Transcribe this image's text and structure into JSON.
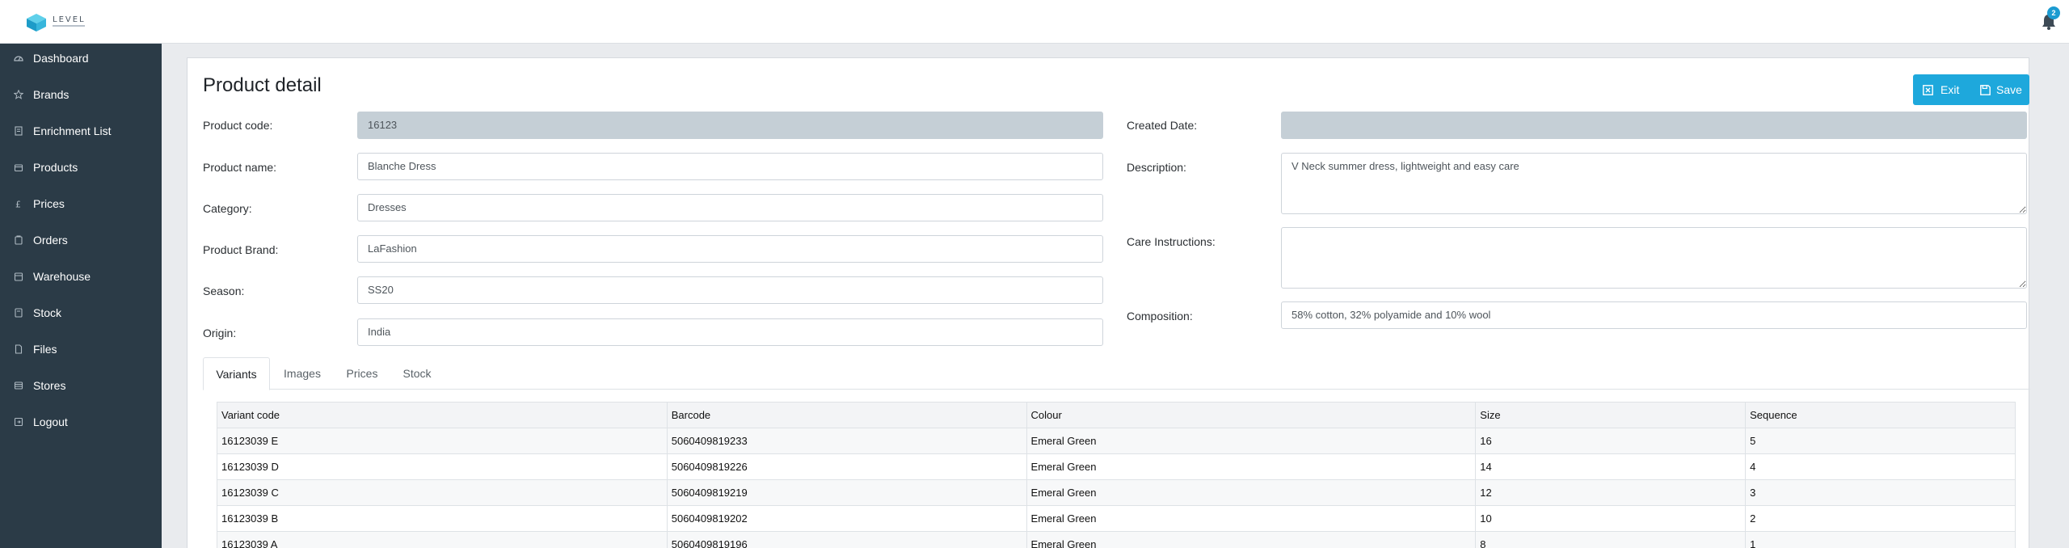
{
  "logo": {
    "text": "LEVEL"
  },
  "notifications": {
    "count": "2"
  },
  "sidebar": {
    "items": [
      {
        "label": "Dashboard",
        "icon": "dashboard-icon"
      },
      {
        "label": "Brands",
        "icon": "star-icon"
      },
      {
        "label": "Enrichment List",
        "icon": "document-icon"
      },
      {
        "label": "Products",
        "icon": "box-icon"
      },
      {
        "label": "Prices",
        "icon": "pound-icon"
      },
      {
        "label": "Orders",
        "icon": "cart-icon"
      },
      {
        "label": "Warehouse",
        "icon": "warehouse-icon"
      },
      {
        "label": "Stock",
        "icon": "stock-icon"
      },
      {
        "label": "Files",
        "icon": "file-icon"
      },
      {
        "label": "Stores",
        "icon": "store-icon"
      },
      {
        "label": "Logout",
        "icon": "logout-icon"
      }
    ]
  },
  "page": {
    "title": "Product detail"
  },
  "toolbar": {
    "exit_label": "Exit",
    "save_label": "Save"
  },
  "form": {
    "product_code": {
      "label": "Product code:",
      "value": "16123"
    },
    "product_name": {
      "label": "Product name:",
      "value": "Blanche Dress"
    },
    "category": {
      "label": "Category:",
      "value": "Dresses"
    },
    "product_brand": {
      "label": "Product Brand:",
      "value": "LaFashion"
    },
    "season": {
      "label": "Season:",
      "value": "SS20"
    },
    "origin": {
      "label": "Origin:",
      "value": "India"
    },
    "created_date": {
      "label": "Created Date:",
      "value": ""
    },
    "description": {
      "label": "Description:",
      "value": "V Neck summer dress, lightweight and easy care"
    },
    "care_instructions": {
      "label": "Care Instructions:",
      "value": ""
    },
    "composition": {
      "label": "Composition:",
      "value": "58% cotton, 32% polyamide and 10% wool"
    }
  },
  "tabs": [
    {
      "label": "Variants",
      "active": true
    },
    {
      "label": "Images",
      "active": false
    },
    {
      "label": "Prices",
      "active": false
    },
    {
      "label": "Stock",
      "active": false
    }
  ],
  "variants": {
    "columns": [
      "Variant code",
      "Barcode",
      "Colour",
      "Size",
      "Sequence"
    ],
    "rows": [
      [
        "16123039 E",
        "5060409819233",
        "Emeral Green",
        "16",
        "5"
      ],
      [
        "16123039 D",
        "5060409819226",
        "Emeral Green",
        "14",
        "4"
      ],
      [
        "16123039 C",
        "5060409819219",
        "Emeral Green",
        "12",
        "3"
      ],
      [
        "16123039 B",
        "5060409819202",
        "Emeral Green",
        "10",
        "2"
      ],
      [
        "16123039 A",
        "5060409819196",
        "Emeral Green",
        "8",
        "1"
      ]
    ]
  },
  "colors": {
    "sidebar_bg": "#2b3b47",
    "accent": "#1ea8dc",
    "readonly_bg": "#c5cfd6"
  }
}
